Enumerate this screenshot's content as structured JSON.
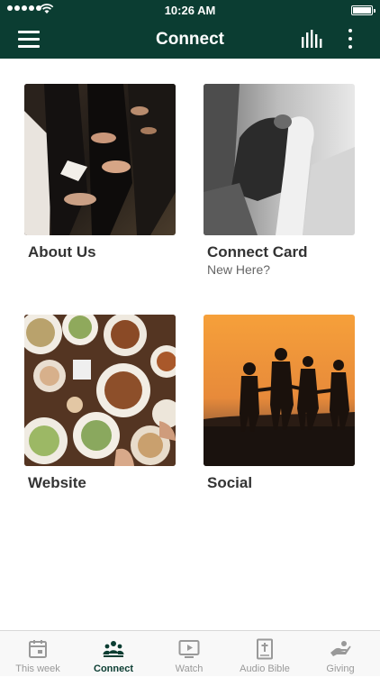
{
  "status_bar": {
    "time": "10:26 AM"
  },
  "header": {
    "title": "Connect"
  },
  "cards": [
    {
      "label": "About Us",
      "sub": ""
    },
    {
      "label": "Connect Card",
      "sub": "New Here?"
    },
    {
      "label": "Website",
      "sub": ""
    },
    {
      "label": "Social",
      "sub": ""
    }
  ],
  "tabbar": {
    "items": [
      {
        "label": "This week",
        "icon": "calendar-icon"
      },
      {
        "label": "Connect",
        "icon": "people-icon",
        "active": true
      },
      {
        "label": "Watch",
        "icon": "play-icon"
      },
      {
        "label": "Audio Bible",
        "icon": "bible-icon"
      },
      {
        "label": "Giving",
        "icon": "hand-icon"
      }
    ]
  },
  "colors": {
    "brand": "#0b3d32",
    "active_tab": "#0b3d32",
    "inactive_tab": "#999999"
  }
}
